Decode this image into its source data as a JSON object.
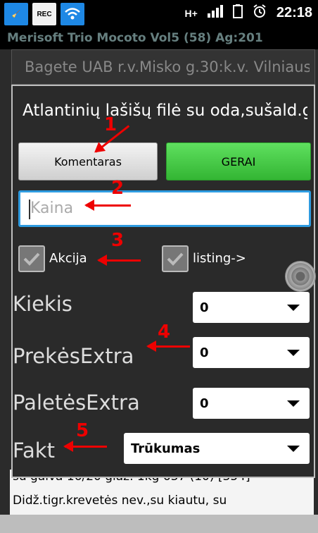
{
  "status_bar": {
    "left_icons": [
      "cleaner-icon",
      "rec-icon",
      "wifi-icon"
    ],
    "rec_label": "REC",
    "network": "H+",
    "time": "22:18"
  },
  "app": {
    "title": "Merisoft Trio Mocoto Vol5 (58) Ag:201",
    "outer_dialog_title": "Bagete UAB r.v.Misko g.30:k.v. Vilniaus",
    "list_row_1": "su galva 16/20 glaz. 1kg 637 (10) [354]",
    "list_row_2": "Didž.tigr.krevetės nev.,su kiautu, su"
  },
  "dialog": {
    "title": "Atlantinių lašišų filė su oda,sušald.g",
    "comment_button": "Komentaras",
    "ok_button": "GERAI",
    "price_placeholder": "Kaina",
    "checkbox_1_label": "Akcija",
    "checkbox_2_label": "listing->",
    "fields": [
      {
        "label": "Kiekis",
        "value": "0"
      },
      {
        "label": "PrekėsExtra",
        "value": "0"
      },
      {
        "label": "PaletėsExtra",
        "value": "0"
      },
      {
        "label": "Fakt",
        "value": "Trūkumas"
      }
    ]
  },
  "annotations": [
    "1",
    "2",
    "3",
    "4",
    "5"
  ],
  "colors": {
    "ok_button": "#44c944",
    "input_focus": "#2e9be0",
    "annotation": "#e00000"
  }
}
